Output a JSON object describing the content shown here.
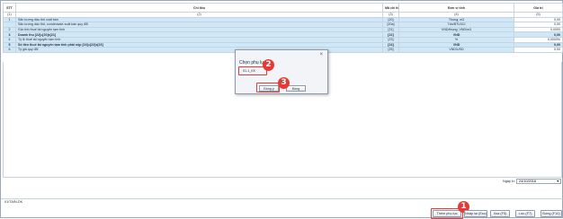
{
  "table": {
    "headers": [
      "STT",
      "Chỉ tiêu",
      "Mã chỉ tiêu",
      "Đơn vị tính",
      "Giá trị"
    ],
    "index_row": [
      "(1)",
      "(2)",
      "(3)",
      "(4)",
      "(5)"
    ],
    "rows": [
      {
        "stt": "1",
        "label": "Sản lượng dầu thô xuất bán",
        "code": "[20]",
        "unit": "Thùng; m3",
        "value": "0,00",
        "bold": false
      },
      {
        "stt": "",
        "label": "Sản lượng dầu thô, condensate xuất bán quy đổi",
        "code": "[20a]",
        "unit": "Tấn/BTU/GJ",
        "value": "0,00",
        "bold": false
      },
      {
        "stt": "2",
        "label": "Giá tính thuế tài nguyên tạm tính",
        "code": "[21]",
        "unit": "VND/thùng; VND/m3",
        "value": "0,0000",
        "bold": false
      },
      {
        "stt": "3",
        "label": "Doanh thu [22]=[20]x[21]",
        "code": "[22]",
        "unit": "VND",
        "value": "0,00",
        "bold": true
      },
      {
        "stt": "4",
        "label": "Tỷ lệ thuế tài nguyên tạm tính",
        "code": "[23]",
        "unit": "%",
        "value": "0,0000%",
        "bold": false
      },
      {
        "stt": "5",
        "label": "Số tiền thuế tài nguyên tạm tính phải nộp [24]=[22]x[23]",
        "code": "[24]",
        "unit": "VND",
        "value": "0,00",
        "bold": true
      },
      {
        "stt": "6",
        "label": "Tỷ giá quy đổi",
        "code": "[25]",
        "unit": "VND/USD",
        "value": "0,00",
        "bold": false
      }
    ]
  },
  "date": {
    "label": "Ngày kí:",
    "value": "24/10/2016"
  },
  "tab": {
    "label": "01/TAIN-DK"
  },
  "buttons": {
    "add_appendix": "Thêm phụ lục",
    "reload": "Nhập lại (Esc)",
    "delete": "Xóa (F5)",
    "save": "Lưu (F7)",
    "close": "Đóng (F10)"
  },
  "dialog": {
    "title": "Chọn phụ lục",
    "close": "×",
    "option": "01-1_KK",
    "ok": "Đồng ý",
    "cancel": "Đóng"
  },
  "annotations": {
    "one": "1",
    "two": "2",
    "three": "3"
  },
  "colors": {
    "row_highlight": "#cfe8f7",
    "annotation": "#e53935"
  }
}
